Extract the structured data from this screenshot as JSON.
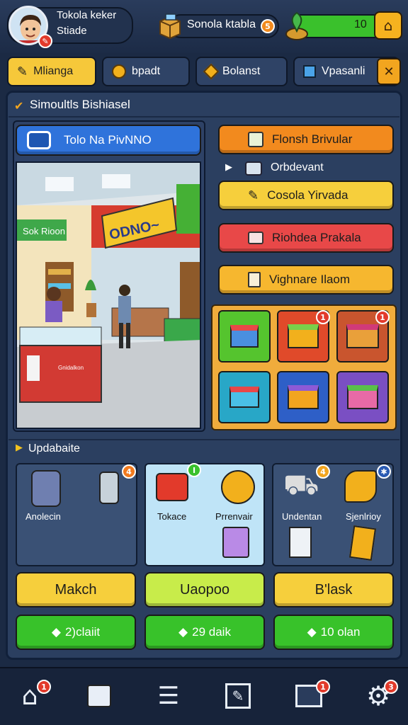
{
  "profile": {
    "name": "Tokola keker",
    "subtitle": "Stiade"
  },
  "header": {
    "store_label": "Sonola ktabla",
    "store_badge": "5",
    "energy_value": "10"
  },
  "tabs": [
    {
      "label": "Mlianga"
    },
    {
      "label": "bpadt"
    },
    {
      "label": "Bolanst"
    },
    {
      "label": "Vpasanli"
    }
  ],
  "panel": {
    "title": "Simoultls Bishiasel"
  },
  "shop": {
    "name_button": "Tolo Na PivNNO",
    "sign_text": "ODNO~",
    "wall_sign": "Sok Rioon",
    "counter_text": "Gnidalkon"
  },
  "actions": {
    "btn1": "Flonsh Brivular",
    "row_label": "Orbdevant",
    "btn2": "Cosola Yirvada",
    "btn3": "Riohdea Prakala",
    "btn4": "Vighnare Ilaom"
  },
  "item_badges": [
    "1",
    "1"
  ],
  "upgrade": {
    "title": "Updabaite",
    "card1_labels": [
      "Anolecin"
    ],
    "card2_labels": [
      "Tokace",
      "Prrenvair"
    ],
    "card3_labels": [
      "Undentan",
      "Sjenlrioy"
    ],
    "card1_badge": "4",
    "card2_badge": "I",
    "card3_badge": "4"
  },
  "buttons": {
    "top": [
      "Makch",
      "Uaopoo",
      "B'lask"
    ],
    "bottom": [
      "2)claiit",
      "29 daik",
      "10 olan"
    ]
  },
  "nav_badges": [
    "1",
    "",
    "",
    "",
    "1",
    "3"
  ],
  "colors": {
    "orange": "#f28a1e",
    "yellow": "#f6cf3c",
    "red": "#e84848",
    "green": "#38c22a",
    "blue": "#2f6fd8"
  }
}
